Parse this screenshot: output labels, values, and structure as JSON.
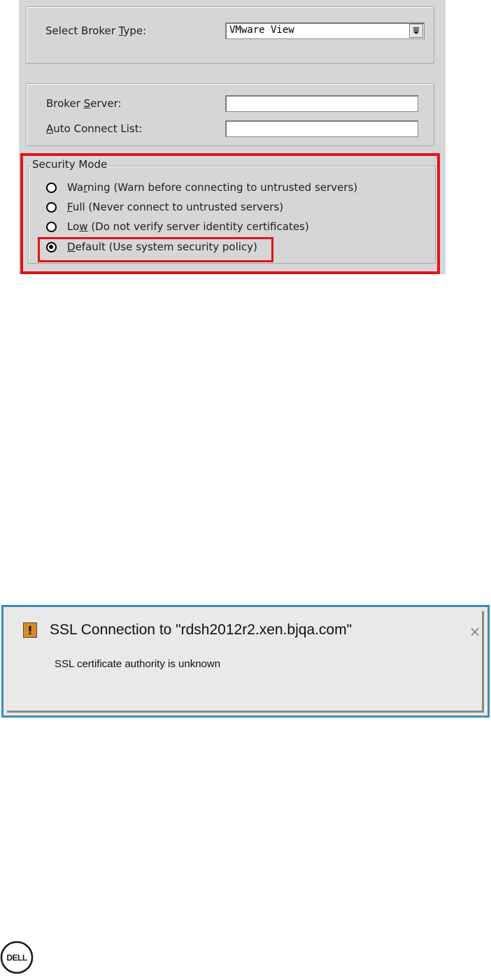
{
  "broker_type": {
    "label_pre": "Select Broker ",
    "label_mnemonic": "T",
    "label_post": "ype:",
    "value": "VMware View"
  },
  "broker_server": {
    "label_pre": "Broker ",
    "label_mnemonic": "S",
    "label_post": "erver:",
    "value": ""
  },
  "auto_connect": {
    "label_pre": "",
    "label_mnemonic": "A",
    "label_post": "uto Connect List:",
    "value": ""
  },
  "security_mode": {
    "legend": "Security Mode",
    "options": [
      {
        "pre": "Wa",
        "mnemonic": "r",
        "post": "ning (Warn before connecting to untrusted servers)",
        "selected": false
      },
      {
        "pre": "",
        "mnemonic": "F",
        "post": "ull (Never connect to untrusted servers)",
        "selected": false
      },
      {
        "pre": "Lo",
        "mnemonic": "w",
        "post": " (Do not verify server identity certificates)",
        "selected": false
      },
      {
        "pre": "",
        "mnemonic": "D",
        "post": "efault (Use system security policy)",
        "selected": true
      }
    ],
    "highlight_color": "#e0141b"
  },
  "ssl_dialog": {
    "title": "SSL Connection to \"rdsh2012r2.xen.bjqa.com\"",
    "message": "SSL certificate authority is unknown",
    "close_glyph": "×",
    "icon": "warning-icon",
    "accent_color": "#1f8fd6"
  },
  "footer": {
    "logo_text": "DELL",
    "logo_icon": "dell-logo"
  }
}
